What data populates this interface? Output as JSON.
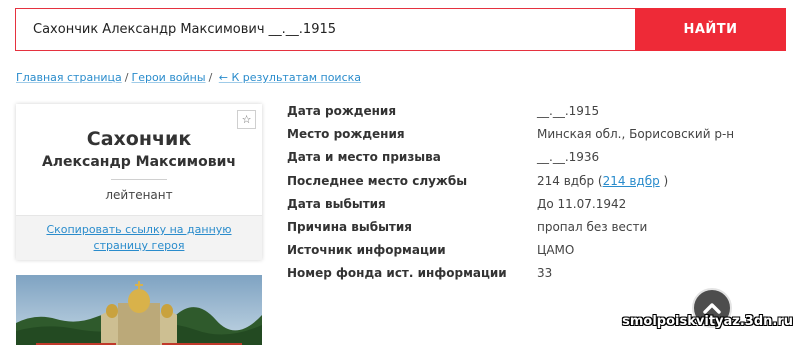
{
  "search": {
    "query": "Сахончик Александр Максимович __.__.1915",
    "button_label": "НАЙТИ"
  },
  "breadcrumb": {
    "home": "Главная страница",
    "separator": "/",
    "heroes": "Герои войны",
    "back": "← К результатам поиска"
  },
  "hero": {
    "surname": "Сахончик",
    "name": "Александр Максимович",
    "rank": "лейтенант",
    "copy_link": "Скопировать ссылку на данную страницу героя",
    "favorite_icon": "star-icon"
  },
  "info": {
    "rows": [
      {
        "label": "Дата рождения",
        "value": "__.__.1915"
      },
      {
        "label": "Место рождения",
        "value": "Минская обл., Борисовский р-н"
      },
      {
        "label": "Дата и место призыва",
        "value": "__.__.1936"
      },
      {
        "label": "Последнее место службы",
        "value_prefix": "214 вдбр (",
        "value_link": "214 вдбр",
        "value_suffix": ")"
      },
      {
        "label": "Дата выбытия",
        "value": "До 11.07.1942"
      },
      {
        "label": "Причина выбытия",
        "value": "пропал без вести"
      },
      {
        "label": "Источник информации",
        "value": "ЦАМО"
      },
      {
        "label": "Номер фонда ист. информации",
        "value": "33"
      }
    ]
  },
  "scroll_up_icon": "chevron-up-icon",
  "watermark": "smolpoiskvityaz.3dn.ru",
  "colors": {
    "accent_red": "#ee2a37",
    "link_blue": "#2a8ccc"
  }
}
